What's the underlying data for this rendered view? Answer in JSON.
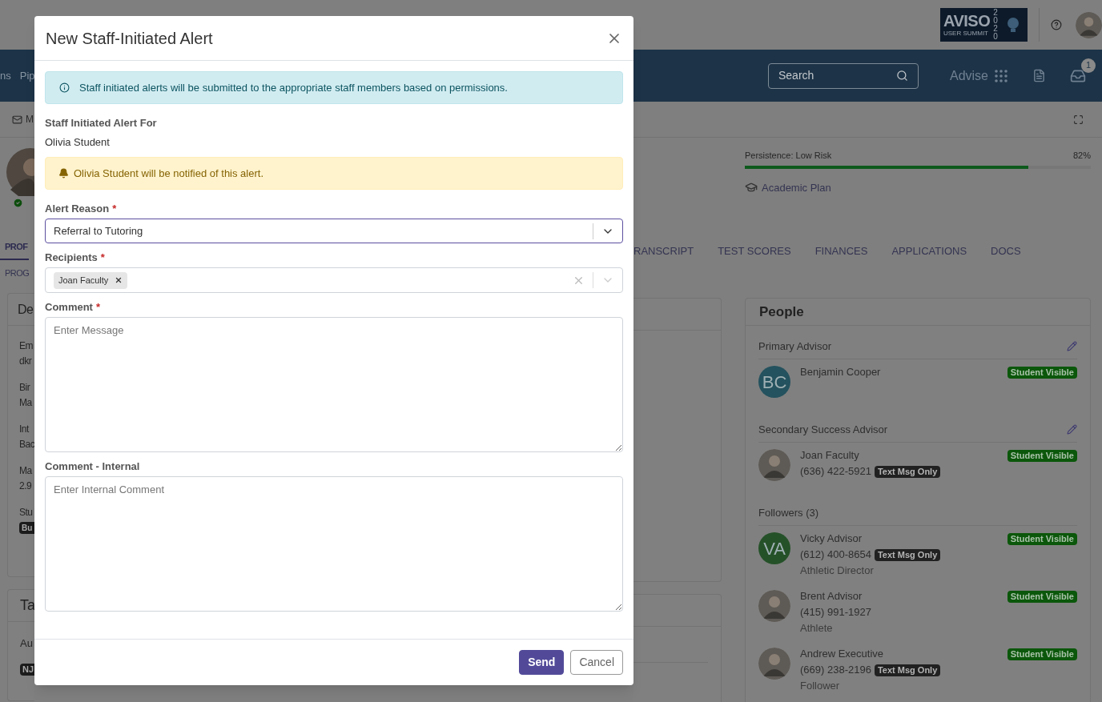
{
  "header": {
    "logo": {
      "word": "AVISO",
      "caption": "USER SUMMIT",
      "year": "2020"
    }
  },
  "nav": {
    "fragments": [
      "ns",
      "Pip"
    ],
    "search": {
      "placeholder": "Search"
    },
    "advise": "Advise",
    "inbox_badge": "1"
  },
  "toolbar": {
    "fragment": "M"
  },
  "tabs": [
    {
      "label": "PROF",
      "selected": true
    },
    {
      "label": "RANSCRIPT",
      "selected": false
    },
    {
      "label": "TEST SCORES",
      "selected": false
    },
    {
      "label": "FINANCES",
      "selected": false
    },
    {
      "label": "APPLICATIONS",
      "selected": false
    },
    {
      "label": "DOCS",
      "selected": false
    }
  ],
  "secondary_tab": "PROG",
  "persistence": {
    "label": "Persistence: Low Risk",
    "reading": "82%",
    "level": 0.82
  },
  "academic_plan": "Academic Plan",
  "details_card": {
    "title": "De",
    "lines": [
      "Em",
      "dkr",
      "Bir",
      "Ma",
      "Int",
      "Bac",
      "Ma",
      "2.9",
      "Stu"
    ],
    "badge": "Bu"
  },
  "tasks_card": {
    "title": "Ta",
    "line": "Au",
    "badge": "NJ"
  },
  "people": {
    "title": "People",
    "sections": [
      {
        "title": "Primary Advisor",
        "editable": true,
        "people": [
          {
            "name": "Benjamin Cooper",
            "avatar": {
              "kind": "initials",
              "initials": "BC",
              "color": "#24525e"
            },
            "badge": "Student Visible"
          }
        ]
      },
      {
        "title": "Secondary Success Advisor",
        "editable": true,
        "people": [
          {
            "name": "Joan Faculty",
            "avatar": {
              "kind": "photo"
            },
            "phone": "(636) 422-5921",
            "phone_tag": "Text Msg Only",
            "badge": "Student Visible"
          }
        ]
      },
      {
        "title": "Followers (3)",
        "editable": false,
        "people": [
          {
            "name": "Vicky Advisor",
            "avatar": {
              "kind": "initials",
              "initials": "VA",
              "color": "#255128"
            },
            "phone": "(612) 400-8654",
            "phone_tag": "Text Msg Only",
            "role": "Athletic Director",
            "badge": "Student Visible"
          },
          {
            "name": "Brent Advisor",
            "avatar": {
              "kind": "photo"
            },
            "phone": "(415) 991-1927",
            "role": "Athlete",
            "badge": "Student Visible"
          },
          {
            "name": "Andrew Executive",
            "avatar": {
              "kind": "photo"
            },
            "phone": "(669) 238-2196",
            "phone_tag": "Text Msg Only",
            "role": "Follower",
            "badge": "Student Visible"
          }
        ]
      }
    ]
  },
  "modal": {
    "title": "New Staff-Initiated Alert",
    "info": "Staff initiated alerts will be submitted to the appropriate staff members based on permissions.",
    "for_label": "Staff Initiated Alert For",
    "for_value": "Olivia Student",
    "notice": "Olivia Student will be notified of this alert.",
    "fields": [
      {
        "kind": "select",
        "label": "Alert Reason",
        "required_mark": "*",
        "value": "Referral to Tutoring",
        "focused": true
      },
      {
        "kind": "multiselect",
        "label": "Recipients",
        "required_mark": "*",
        "chips": [
          "Joan Faculty"
        ],
        "focused": false
      },
      {
        "kind": "textarea",
        "label": "Comment",
        "required_mark": "*",
        "placeholder": "Enter Message",
        "focused": false
      },
      {
        "kind": "textarea",
        "label": "Comment - Internal",
        "placeholder": "Enter Internal Comment",
        "focused": false
      }
    ],
    "buttons": [
      {
        "label": "Send",
        "kind": "primary"
      },
      {
        "label": "Cancel",
        "kind": "secondary"
      }
    ]
  }
}
